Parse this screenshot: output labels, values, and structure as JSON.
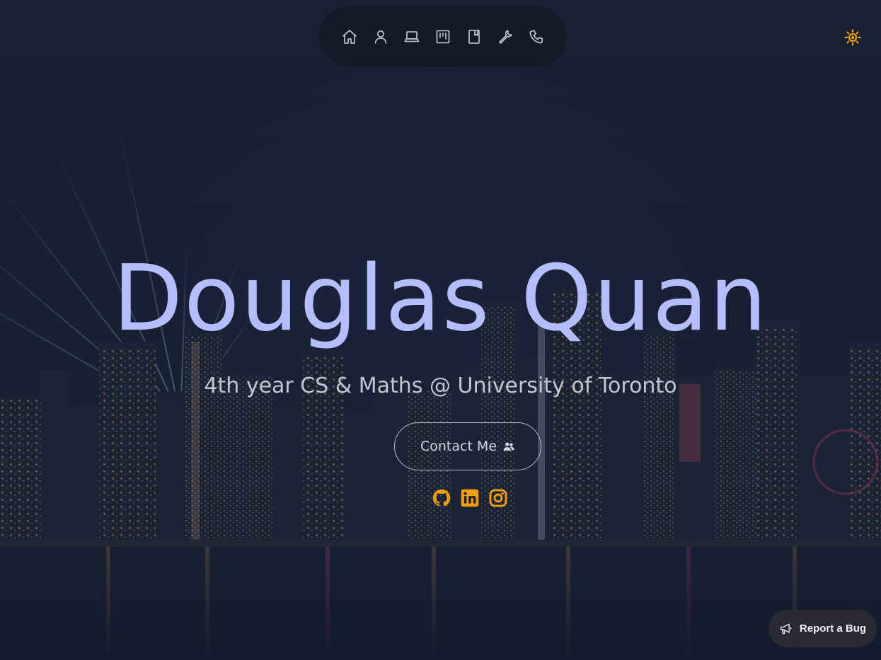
{
  "theme": {
    "accent": "#f59e0b",
    "title_color": "#b4befc",
    "nav_background": "#141a26"
  },
  "nav": {
    "items": [
      {
        "icon": "home-icon",
        "label": "Home"
      },
      {
        "icon": "user-icon",
        "label": "About"
      },
      {
        "icon": "laptop-icon",
        "label": "Experience"
      },
      {
        "icon": "board-icon",
        "label": "Projects"
      },
      {
        "icon": "bookmark-icon",
        "label": "Education"
      },
      {
        "icon": "wrench-icon",
        "label": "Skills"
      },
      {
        "icon": "phone-icon",
        "label": "Contact"
      }
    ]
  },
  "theme_toggle": {
    "icon": "sun-icon"
  },
  "hero": {
    "title": "Douglas Quan",
    "subtitle": "4th year CS & Maths @ University of Toronto",
    "contact_label": "Contact Me",
    "contact_icon": "users-icon"
  },
  "socials": [
    {
      "icon": "github-icon"
    },
    {
      "icon": "linkedin-icon"
    },
    {
      "icon": "instagram-icon"
    }
  ],
  "report_bug": {
    "label": "Report a Bug",
    "icon": "megaphone-icon"
  }
}
